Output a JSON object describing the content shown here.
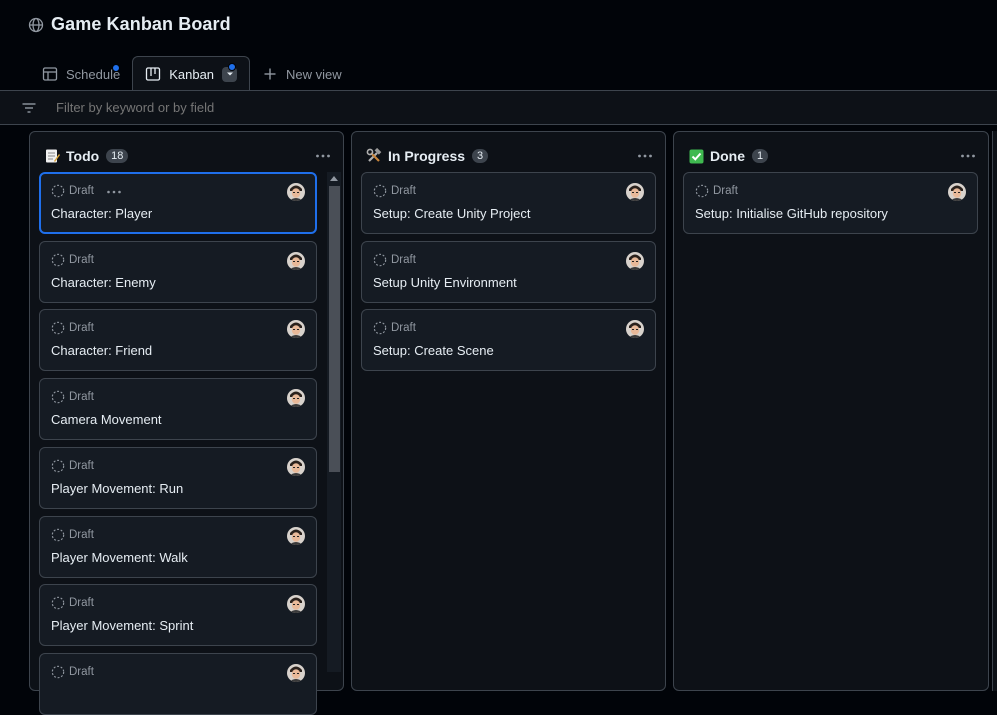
{
  "header": {
    "title": "Game Kanban Board",
    "icon": "globe-icon"
  },
  "tabs": [
    {
      "label": "Schedule",
      "icon": "table-icon",
      "has_unsaved_dot": true
    },
    {
      "label": "Kanban",
      "icon": "board-icon",
      "has_unsaved_dot": true,
      "active": true
    },
    {
      "label": "New view",
      "icon": "plus-icon"
    }
  ],
  "filter": {
    "placeholder": "Filter by keyword or by field",
    "icon": "filter-icon"
  },
  "columns": [
    {
      "name": "Todo",
      "emoji": "memo",
      "count": "18",
      "cards": [
        {
          "status": "Draft",
          "title": "Character: Player",
          "selected": true
        },
        {
          "status": "Draft",
          "title": "Character: Enemy"
        },
        {
          "status": "Draft",
          "title": "Character: Friend"
        },
        {
          "status": "Draft",
          "title": "Camera Movement"
        },
        {
          "status": "Draft",
          "title": "Player Movement: Run"
        },
        {
          "status": "Draft",
          "title": "Player Movement: Walk"
        },
        {
          "status": "Draft",
          "title": "Player Movement: Sprint"
        },
        {
          "status": "Draft",
          "title": ""
        }
      ]
    },
    {
      "name": "In Progress",
      "emoji": "hammer-and-wrench",
      "count": "3",
      "cards": [
        {
          "status": "Draft",
          "title": "Setup: Create Unity Project"
        },
        {
          "status": "Draft",
          "title": "Setup Unity Environment"
        },
        {
          "status": "Draft",
          "title": "Setup: Create Scene"
        }
      ]
    },
    {
      "name": "Done",
      "emoji": "check-mark-button",
      "count": "1",
      "cards": [
        {
          "status": "Draft",
          "title": "Setup: Initialise GitHub repository"
        }
      ]
    }
  ],
  "colors": {
    "background": "#010409",
    "surface": "#0d1117",
    "card": "#151b23",
    "border": "#3d444d",
    "accent": "#1f6feb",
    "text": "#e6edf3",
    "muted": "#9198a1",
    "done_green": "#3fb950"
  }
}
